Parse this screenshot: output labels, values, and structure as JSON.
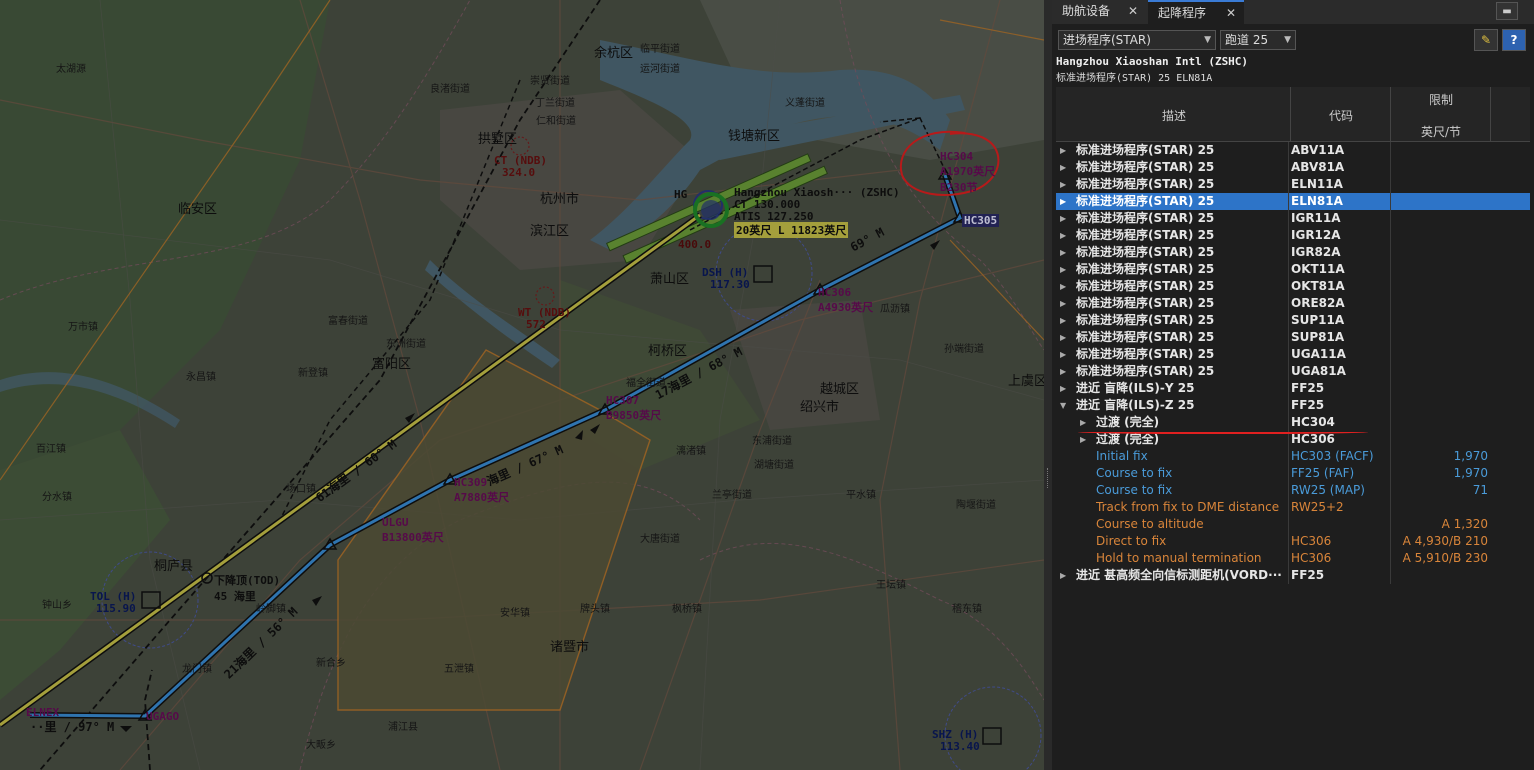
{
  "map": {
    "airport": {
      "name": "Hangzhou Xiaosh··· (ZSHC)",
      "freq1": "CT 130.000",
      "freq2": "ATIS 127.250",
      "rwy": "20英尺 L 11823英尺",
      "elev": "400.0",
      "icao": "HG"
    },
    "navaids": [
      {
        "id": "dsh",
        "name": "DSH (H)",
        "freq": "117.30"
      },
      {
        "id": "tol",
        "name": "TOL (H)",
        "freq": "115.90"
      },
      {
        "id": "shz",
        "name": "SHZ (H)",
        "freq": "113.40"
      },
      {
        "id": "ctndb",
        "name": "CT (NDB)",
        "freq": "324.0"
      },
      {
        "id": "wtndb",
        "name": "WT (NDB)",
        "freq": "572"
      }
    ],
    "waypoints": [
      {
        "id": "hc304",
        "lines": [
          "HC304",
          "A1970英尺",
          "B230节"
        ]
      },
      {
        "id": "hc305",
        "lines": [
          "HC305"
        ]
      },
      {
        "id": "hc306",
        "lines": [
          "HC306",
          "A4930英尺"
        ]
      },
      {
        "id": "hc307",
        "lines": [
          "HC307",
          "B9850英尺"
        ]
      },
      {
        "id": "hc309",
        "lines": [
          "HC309",
          "A7880英尺"
        ]
      },
      {
        "id": "ulgu",
        "lines": [
          "ULGU",
          "B13800英尺"
        ]
      },
      {
        "id": "ugago",
        "lines": [
          "UGAGO"
        ]
      },
      {
        "id": "elnex",
        "lines": [
          "ELNEX"
        ]
      },
      {
        "id": "tod",
        "lines": [
          "下降顶(TOD)",
          "45 海里"
        ]
      }
    ],
    "legs": [
      {
        "id": "leg1",
        "text": "69° M"
      },
      {
        "id": "leg2",
        "text": "17海里 / 68° M"
      },
      {
        "id": "leg3",
        "text": "海里 / 67° M"
      },
      {
        "id": "leg4",
        "text": "21海里 / 56° M"
      },
      {
        "id": "leg5",
        "text": "61海里 / 60° M"
      },
      {
        "id": "leg6",
        "text": "··里 / 97° M"
      }
    ],
    "places": [
      "余杭区",
      "钱塘新区",
      "拱墅区",
      "杭州市",
      "滨江区",
      "临安区",
      "富阳区",
      "桐庐县",
      "绍兴市",
      "诸暨市",
      "太湖源",
      "临平街道",
      "运河街道",
      "丁兰街道",
      "崇贤街道",
      "仁和街道",
      "良渚街道",
      "萧山区",
      "义蓬街道",
      "瓜沥镇",
      "柯桥区",
      "越城区",
      "上虞区",
      "大唐街道",
      "枫桥镇",
      "牌头镇",
      "安华镇",
      "五泄镇",
      "浦江县",
      "岭脚镇",
      "龙门镇",
      "场口镇",
      "新登镇",
      "富春街道",
      "东洲街道",
      "万市镇",
      "永昌镇",
      "分水镇",
      "百江镇",
      "钟山乡",
      "新合乡",
      "大畈乡",
      "平水镇",
      "王坛镇",
      "稽东镇",
      "陶堰街道",
      "孙端街道",
      "东浦街道",
      "湖塘街道",
      "漓渚镇",
      "兰亭街道",
      "福全街道"
    ]
  },
  "panel": {
    "tabs": [
      {
        "label": "助航设备"
      },
      {
        "label": "起降程序"
      }
    ],
    "proc_select": "进场程序(STAR)",
    "rwy_select": "跑道 25",
    "airport_title": "Hangzhou Xiaoshan Intl (ZSHC)",
    "subtitle": "标准进场程序(STAR) 25 ELN81A",
    "columns": {
      "desc": "描述",
      "code": "代码",
      "limit": "限制",
      "limit_unit": "英尺/节"
    },
    "rows": [
      {
        "desc": "标准进场程序(STAR) 25",
        "code": "ABV11A",
        "lim": "",
        "type": "star"
      },
      {
        "desc": "标准进场程序(STAR) 25",
        "code": "ABV81A",
        "lim": "",
        "type": "star"
      },
      {
        "desc": "标准进场程序(STAR) 25",
        "code": "ELN11A",
        "lim": "",
        "type": "star"
      },
      {
        "desc": "标准进场程序(STAR) 25",
        "code": "ELN81A",
        "lim": "",
        "type": "sel"
      },
      {
        "desc": "标准进场程序(STAR) 25",
        "code": "IGR11A",
        "lim": "",
        "type": "star"
      },
      {
        "desc": "标准进场程序(STAR) 25",
        "code": "IGR12A",
        "lim": "",
        "type": "star"
      },
      {
        "desc": "标准进场程序(STAR) 25",
        "code": "IGR82A",
        "lim": "",
        "type": "star"
      },
      {
        "desc": "标准进场程序(STAR) 25",
        "code": "OKT11A",
        "lim": "",
        "type": "star"
      },
      {
        "desc": "标准进场程序(STAR) 25",
        "code": "OKT81A",
        "lim": "",
        "type": "star"
      },
      {
        "desc": "标准进场程序(STAR) 25",
        "code": "ORE82A",
        "lim": "",
        "type": "star"
      },
      {
        "desc": "标准进场程序(STAR) 25",
        "code": "SUP11A",
        "lim": "",
        "type": "star"
      },
      {
        "desc": "标准进场程序(STAR) 25",
        "code": "SUP81A",
        "lim": "",
        "type": "star"
      },
      {
        "desc": "标准进场程序(STAR) 25",
        "code": "UGA11A",
        "lim": "",
        "type": "star"
      },
      {
        "desc": "标准进场程序(STAR) 25",
        "code": "UGA81A",
        "lim": "",
        "type": "star"
      },
      {
        "desc": "进近 盲降(ILS)-Y 25",
        "code": "FF25",
        "lim": "",
        "type": "star"
      },
      {
        "desc": "进近 盲降(ILS)-Z 25",
        "code": "FF25",
        "lim": "",
        "type": "open"
      },
      {
        "desc": "过渡 (完全)",
        "code": "HC304",
        "lim": "",
        "type": "trans"
      },
      {
        "desc": "过渡 (完全)",
        "code": "HC306",
        "lim": "",
        "type": "trans"
      },
      {
        "desc": "Initial fix",
        "code": "HC303 (FACF)",
        "lim": "1,970",
        "type": "blue"
      },
      {
        "desc": "Course to fix",
        "code": "FF25 (FAF)",
        "lim": "1,970",
        "type": "blue"
      },
      {
        "desc": "Course to fix",
        "code": "RW25 (MAP)",
        "lim": "71",
        "type": "blue"
      },
      {
        "desc": "Track from fix to DME distance",
        "code": "RW25+2",
        "lim": "",
        "type": "orange"
      },
      {
        "desc": "Course to altitude",
        "code": "",
        "lim": "A 1,320",
        "type": "orange"
      },
      {
        "desc": "Direct to fix",
        "code": "HC306",
        "lim": "A 4,930/B 210",
        "type": "orange"
      },
      {
        "desc": "Hold to manual termination",
        "code": "HC306",
        "lim": "A 5,910/B 230",
        "type": "orange"
      },
      {
        "desc": "进近 甚高频全向信标测距机(VORD···",
        "code": "FF25",
        "lim": "",
        "type": "star"
      }
    ]
  }
}
